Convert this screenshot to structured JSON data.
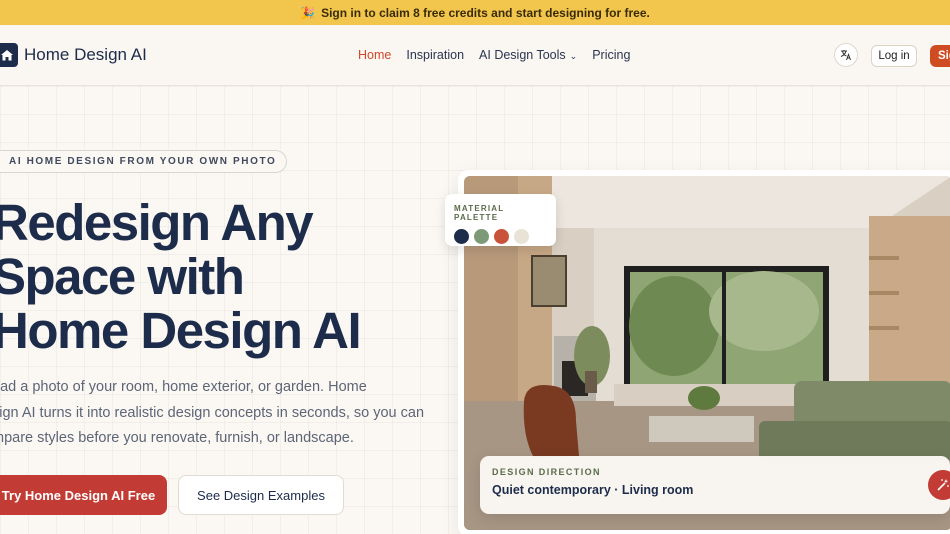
{
  "banner": {
    "emoji": "🎉",
    "text": "Sign in to claim 8 free credits and start designing for free."
  },
  "nav": {
    "brand": "Home Design AI",
    "links": [
      {
        "label": "Home",
        "active": true
      },
      {
        "label": "Inspiration",
        "active": false
      },
      {
        "label": "AI Design Tools",
        "active": false
      },
      {
        "label": "Pricing",
        "active": false
      }
    ],
    "language_icon": "translate-icon",
    "login": "Log in",
    "signup": "Sig"
  },
  "hero": {
    "eyebrow": "AI HOME DESIGN FROM YOUR OWN PHOTO",
    "headline_lines": [
      "Redesign Any",
      "Space with",
      "Home Design AI"
    ],
    "lead_lines": [
      "oad a photo of your room, home exterior, or garden. Home",
      "sign AI turns it into realistic design concepts in seconds, so you can",
      "mpare styles before you renovate, furnish, or landscape."
    ],
    "cta_primary": "Try Home Design AI Free",
    "cta_secondary": "See Design Examples"
  },
  "palette": {
    "title": "MATERIAL PALETTE",
    "colors": [
      "#1d2c4a",
      "#7d9a78",
      "#c9533a",
      "#e9e2d6"
    ]
  },
  "direction": {
    "label": "DESIGN DIRECTION",
    "value": "Quiet contemporary · Living room"
  },
  "colors": {
    "accent": "#d2482a",
    "cta": "#c23b35",
    "banner": "#f2c64c",
    "navy": "#1d2c4a"
  }
}
